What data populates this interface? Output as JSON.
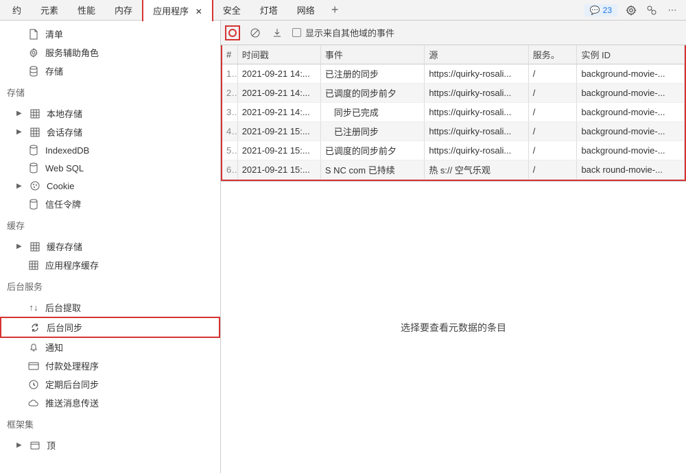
{
  "tabs": {
    "left_label": "约",
    "items": [
      "元素",
      "性能",
      "内存",
      "应用程序",
      "安全",
      "灯塔",
      "网络"
    ],
    "active_index": 3,
    "plus": "+"
  },
  "topright": {
    "badge_icon": "💬",
    "badge_count": "23"
  },
  "sidebar": {
    "app": {
      "items": [
        {
          "icon": "manifest",
          "label": "清单"
        },
        {
          "icon": "gear",
          "label": "服务辅助角色"
        },
        {
          "icon": "db",
          "label": "存储"
        }
      ]
    },
    "storage": {
      "title": "存储",
      "items": [
        {
          "tri": "▶",
          "icon": "grid",
          "label": "本地存储"
        },
        {
          "tri": "▶",
          "icon": "grid",
          "label": "会话存储"
        },
        {
          "tri": "",
          "icon": "db",
          "label": "IndexedDB"
        },
        {
          "tri": "",
          "icon": "db",
          "label": "Web SQL"
        },
        {
          "tri": "▶",
          "icon": "cookie",
          "label": "Cookie"
        },
        {
          "tri": "",
          "icon": "db",
          "label": "信任令牌"
        }
      ]
    },
    "cache": {
      "title": "缓存",
      "items": [
        {
          "tri": "▶",
          "icon": "grid",
          "label": "缓存存储"
        },
        {
          "tri": "",
          "icon": "grid",
          "label": "应用程序缓存"
        }
      ]
    },
    "bgservice": {
      "title": "后台服务",
      "items": [
        {
          "icon": "updown",
          "label": "后台提取"
        },
        {
          "icon": "sync",
          "label": "后台同步",
          "selected": true
        },
        {
          "icon": "bell",
          "label": "通知"
        },
        {
          "icon": "card",
          "label": "付款处理程序"
        },
        {
          "icon": "clock",
          "label": "定期后台同步"
        },
        {
          "icon": "cloud",
          "label": "推送消息传送"
        }
      ]
    },
    "frames": {
      "title": "框架集",
      "items": [
        {
          "tri": "▶",
          "icon": "window",
          "label": "顶"
        }
      ]
    }
  },
  "toolbar": {
    "checkbox_label": "显示来自其他域的事件"
  },
  "table": {
    "headers": [
      "#",
      "时间戳",
      "事件",
      "源",
      "服务。",
      "实例 ID"
    ],
    "rows": [
      {
        "idx": "1.",
        "ts": "2021-09-21 14:...",
        "ev": "已注册的同步",
        "src": "https://quirky-rosali...",
        "svc": "/",
        "inst": "background-movie-..."
      },
      {
        "idx": "2.",
        "ts": "2021-09-21 14:...",
        "ev": "已调度的同步前夕",
        "src": "https://quirky-rosali...",
        "svc": "/",
        "inst": "background-movie-..."
      },
      {
        "idx": "3.",
        "ts": "2021-09-21 14:...",
        "ev": "　同步已完成",
        "src": "https://quirky-rosali...",
        "svc": "/",
        "inst": "background-movie-..."
      },
      {
        "idx": "4.",
        "ts": "2021-09-21 15:...",
        "ev": "　已注册同步",
        "src": "https://quirky-rosali...",
        "svc": "/",
        "inst": "background-movie-..."
      },
      {
        "idx": "5.",
        "ts": "2021-09-21 15:...",
        "ev": "已调度的同步前夕",
        "src": "https://quirky-rosali...",
        "svc": "/",
        "inst": "background-movie-..."
      },
      {
        "idx": "6.",
        "ts": "2021-09-21 15:...",
        "ev": "S NC com 已持续",
        "src": "热 s:// 空气乐观",
        "svc": "/",
        "inst": "back round-movie-..."
      }
    ]
  },
  "detail": {
    "placeholder": "选择要查看元数据的条目"
  }
}
